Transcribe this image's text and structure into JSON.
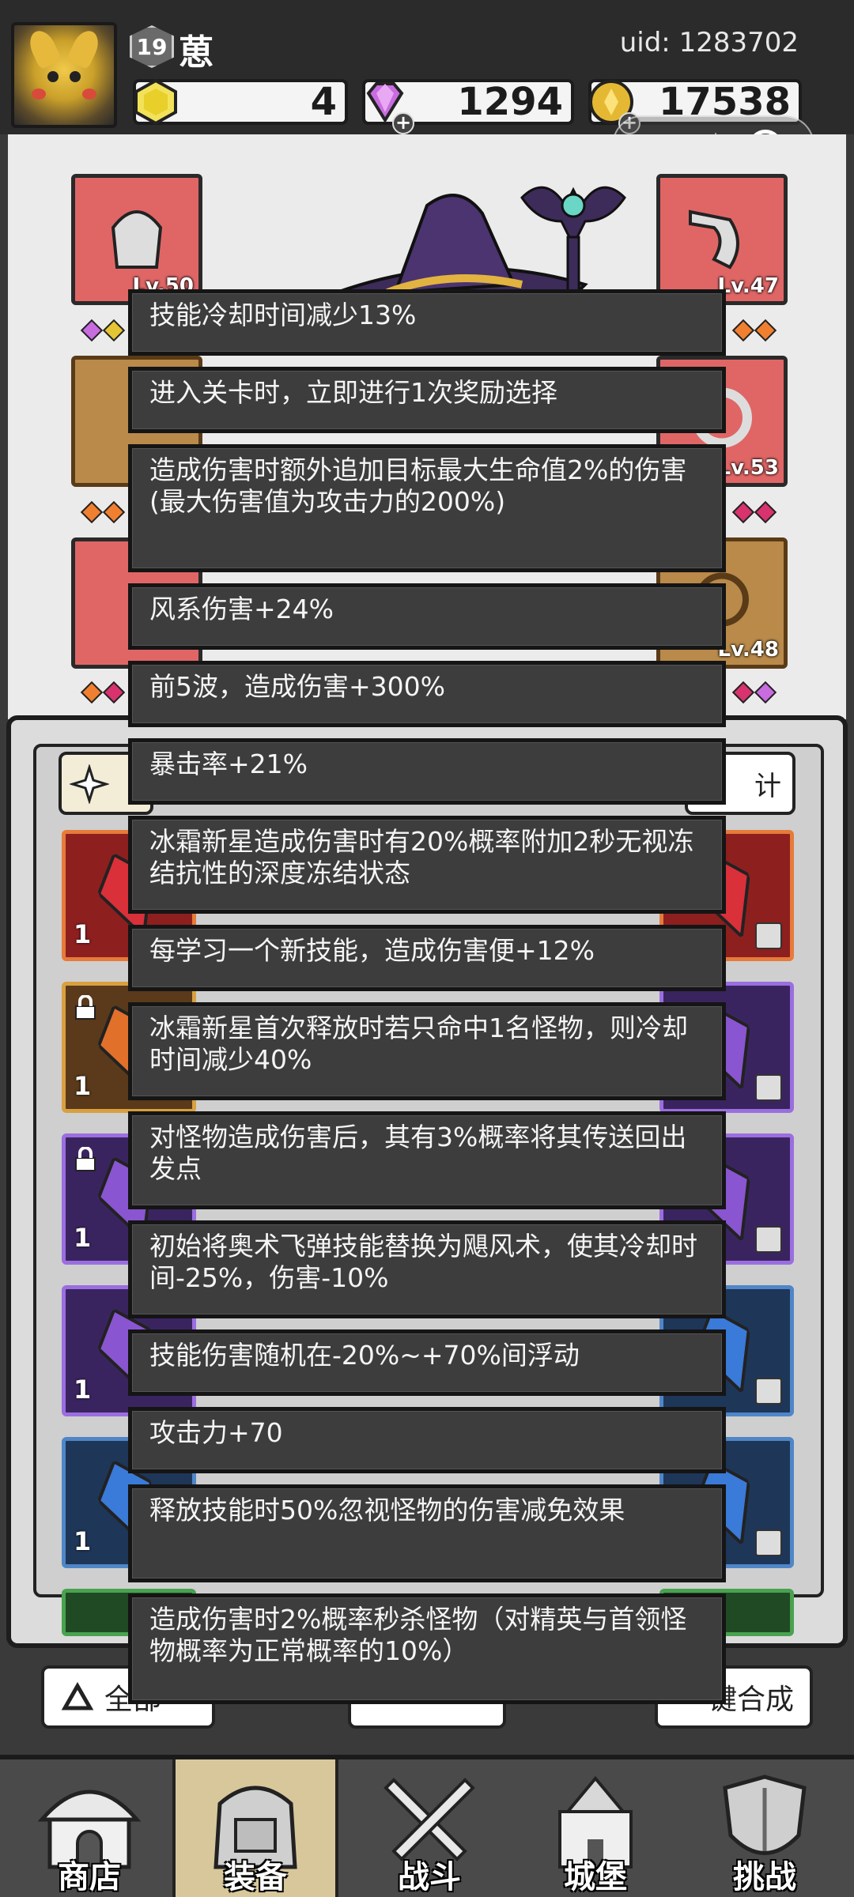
{
  "header": {
    "player_level": "19",
    "player_name": "葸",
    "uid": "uid: 1283702",
    "resources": {
      "energy": "4",
      "diamonds": "1294",
      "coins": "17538"
    },
    "plus": "+"
  },
  "equipment": {
    "slots": [
      {
        "name": "helmet",
        "level": "Lv.50"
      },
      {
        "name": "weapon-right",
        "level": "Lv.47"
      },
      {
        "name": "armor-right",
        "level": "Lv.53"
      },
      {
        "name": "ring-right",
        "level": "Lv.48"
      }
    ]
  },
  "bag": {
    "right_button": "计",
    "item_counts": [
      "1",
      "1",
      "1",
      "1",
      "1"
    ]
  },
  "tooltips": [
    "技能冷却时间减少13%",
    "进入关卡时，立即进行1次奖励选择",
    "造成伤害时额外追加目标最大生命值2%的伤害(最大伤害值为攻击力的200%)",
    "风系伤害+24%",
    "前5波，造成伤害+300%",
    "暴击率+21%",
    "冰霜新星造成伤害时有20%概率附加2秒无视冻结抗性的深度冻结状态",
    "每学习一个新技能，造成伤害便+12%",
    "冰霜新星首次释放时若只命中1名怪物，则冷却时间减少40%",
    "对怪物造成伤害后，其有3%概率将其传送回出发点",
    "初始将奥术飞弹技能替换为飓风术，使其冷却时间-25%，伤害-10%",
    "技能伤害随机在-20%~+70%间浮动",
    "攻击力+70",
    "释放技能时50%忽视怪物的伤害减免效果",
    "造成伤害时2%概率秒杀怪物（对精英与首领怪物概率为正常概率的10%）"
  ],
  "bottom_buttons": {
    "left": "全部",
    "right": "键合成"
  },
  "nav": {
    "items": [
      {
        "label": "商店"
      },
      {
        "label": "装备"
      },
      {
        "label": "战斗"
      },
      {
        "label": "城堡"
      },
      {
        "label": "挑战"
      }
    ],
    "active_index": 1
  },
  "colors": {
    "tooltip_bg": "#3d3d3d",
    "slot_red": "#e06666",
    "nav_active": "#d8c79a"
  }
}
